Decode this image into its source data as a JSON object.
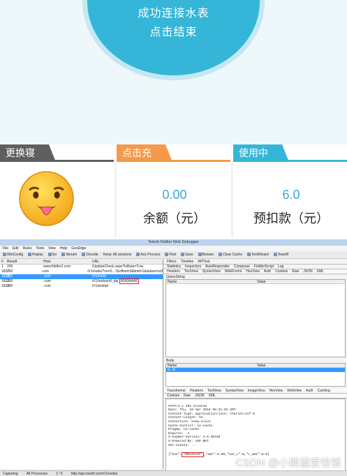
{
  "app": {
    "circle_line1": "成功连接水表",
    "circle_line2": "点击结束",
    "tabs": [
      "更换寝室",
      "点击充值",
      "使用中"
    ],
    "balance_value": "0.00",
    "balance_label": "余额（元）",
    "prepay_value": "6.0",
    "prepay_label": "预扣款（元）"
  },
  "fiddler": {
    "title": "Telerik Fiddler Web Debugger",
    "menu": [
      "File",
      "Edit",
      "Rules",
      "Tools",
      "View",
      "Help",
      "GeoEdge"
    ],
    "toolbar": [
      "WinConfig",
      "Replay",
      "Go",
      "Stream",
      "Decode",
      "Keep: All sessions",
      "Any Process",
      "Find",
      "Save",
      "Browse",
      "Clear Cache",
      "TextWizard",
      "Tearoff"
    ],
    "columns": [
      "#",
      "Result",
      "Host",
      "URL"
    ],
    "sessions": [
      {
        "id": "1",
        "result": "200",
        "host": "www.fiddler2.com",
        "url": "/UpdateCheck.aspx?isBeta=True"
      },
      {
        "id": "1827",
        "result": "200",
        "host": ".com",
        "url": "/r/1/node/?no=0...7&offset=0&limit=1&status=unf"
      },
      {
        "id": "1828",
        "result": "201",
        "host": ".com",
        "url": "/r/1/node"
      },
      {
        "id": "1832",
        "result": "200",
        "host": ".com",
        "url": "/r/1/nodes/of_daj",
        "highlight": "00A3AAAF"
      },
      {
        "id": "1833",
        "result": "200",
        "host": ".com",
        "url": "/r/1/w/sfad"
      }
    ],
    "top_tabs": [
      "Filters",
      "Timeline",
      "APITest"
    ],
    "inspector_tabs": [
      "Statistics",
      "Inspectors",
      "AutoResponder",
      "Composer",
      "FiddlerScript",
      "Log"
    ],
    "request_tabs": [
      "Headers",
      "TextView",
      "SyntaxView",
      "WebForms",
      "HexView",
      "Auth",
      "Cookies",
      "Raw",
      "JSON",
      "XML"
    ],
    "query_label": "QueryString",
    "grid_headers": [
      "Name",
      "Value"
    ],
    "body_label": "Body",
    "body_row": "d_ id",
    "response_tabs": [
      "Transformer",
      "Headers",
      "TextView",
      "SyntaxView",
      "ImageView",
      "HexView",
      "WebView",
      "Auth",
      "Caching"
    ],
    "response_tabs2": [
      "Cookies",
      "Raw",
      "JSON",
      "XML"
    ],
    "response_headers": [
      "HTTP/1.1 201 Created",
      "Date: Thu, 19 Apr 2018 08:21:01 GMT",
      "Content-Type: application/json; charset=utf-8",
      "Content-Length: 51",
      "Connection: keep-alive",
      "Cache-Control: no-cache",
      "Pragma: no-cache",
      "Expires: -1",
      "X-AspNet-Version: 4.0.30319",
      "X-Powered-By: ASP.NET",
      "Set-Cookie: ..."
    ],
    "json_prefix": "{\"hex\":",
    "json_hex": "\"00A3AAAF\"",
    "json_suffix": ",\"amt\":6.00,\"use_c\":0,\"c_amt\":0.0}",
    "status": [
      "Capturing",
      "All Processes",
      "1 / 5",
      "http://api.xiaokf.com/r/1/nodes"
    ],
    "watermark": "CSDN @小熊猫爱恰饭"
  },
  "colors": {
    "accent": "#35b6d8",
    "orange": "#f59a4a",
    "gray": "#5f5f5f",
    "highlight": "#e02020"
  }
}
